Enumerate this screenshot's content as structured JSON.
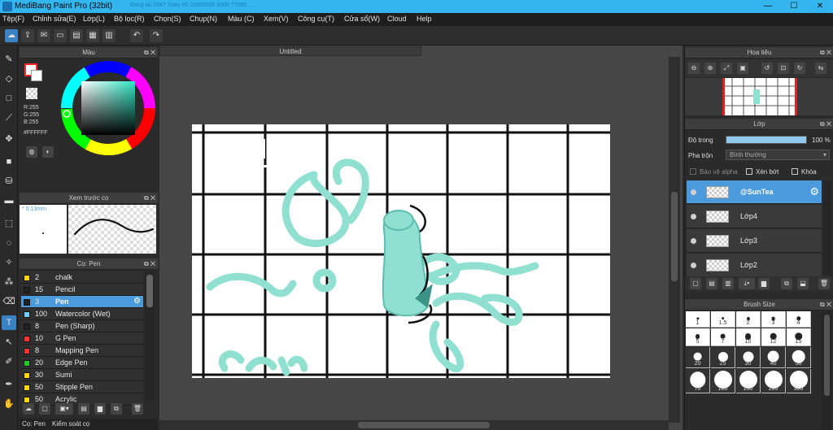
{
  "window": {
    "title": "MediBang Paint Pro (32bit)",
    "ghost_text": "Đang tải 2047  Xoáy 00  10000000  6000  77000  ...",
    "minimize": "—",
    "maximize": "☐",
    "close": "✕"
  },
  "menu": [
    "Tệp(F)",
    "Chỉnh sửa(E)",
    "Lớp(L)",
    "Bộ lọc(R)",
    "Chọn(S)",
    "Chụp(N)",
    "Màu (C)",
    "Xem(V)",
    "Công cụ(T)",
    "Cửa sổ(W)",
    "Cloud",
    "Help"
  ],
  "color_panel": {
    "title": "Màu",
    "r": "R:255",
    "g": "G:255",
    "b": "B:255",
    "hex": "#FFFFFF",
    "primary": "#ff2a2a",
    "wheel_inner": "#3ae0c0"
  },
  "preview_panel": {
    "title": "Xem trước cọ",
    "size": "* 0.13mm"
  },
  "brush_panel": {
    "title": "Cọ: Pen",
    "items": [
      {
        "color": "#ffd700",
        "size": "2",
        "name": "chalk"
      },
      {
        "color": "#222222",
        "size": "15",
        "name": "Pencil"
      },
      {
        "color": "#222222",
        "size": "3",
        "name": "Pen"
      },
      {
        "color": "#6ed0ff",
        "size": "100",
        "name": "Watercolor (Wet)"
      },
      {
        "color": "#222222",
        "size": "8",
        "name": "Pen (Sharp)"
      },
      {
        "color": "#ff3333",
        "size": "10",
        "name": "G Pen"
      },
      {
        "color": "#ff3333",
        "size": "8",
        "name": "Mapping Pen"
      },
      {
        "color": "#22cc22",
        "size": "20",
        "name": "Edge Pen"
      },
      {
        "color": "#ffd700",
        "size": "30",
        "name": "Sumi"
      },
      {
        "color": "#ffd700",
        "size": "50",
        "name": "Stipple Pen"
      },
      {
        "color": "#ffd700",
        "size": "50",
        "name": "Acrylic"
      }
    ]
  },
  "bottom_tabs": [
    "Cọ: Pen",
    "Kiểm soát cọ"
  ],
  "document": {
    "tab": "Untitled"
  },
  "navigator": {
    "title": "Hoa tiêu"
  },
  "layers": {
    "title": "Lớp",
    "opacity_label": "Độ trong",
    "opacity_value": "100 %",
    "opacity": 1.0,
    "blend_label": "Pha trộn",
    "blend_value": "Bình thường",
    "protect_alpha": "Bảo vệ alpha",
    "clipping": "Xén bớt",
    "lock": "Khóa",
    "items": [
      {
        "name": "@SunTea"
      },
      {
        "name": "Lớp4"
      },
      {
        "name": "Lớp3"
      },
      {
        "name": "Lớp2"
      }
    ]
  },
  "brush_size": {
    "title": "Brush Size",
    "rows": [
      [
        "1",
        "1.5",
        "2",
        "3",
        "4"
      ],
      [
        "5",
        "7",
        "10",
        "12",
        "15"
      ],
      [
        "20",
        "25",
        "30",
        "40",
        "50"
      ],
      [
        "70",
        "100",
        "150",
        "200",
        "300"
      ]
    ]
  },
  "colors": {
    "accent": "#4b9adb",
    "stroke": "#8fe0d0",
    "titlebar": "#33b5ee"
  }
}
